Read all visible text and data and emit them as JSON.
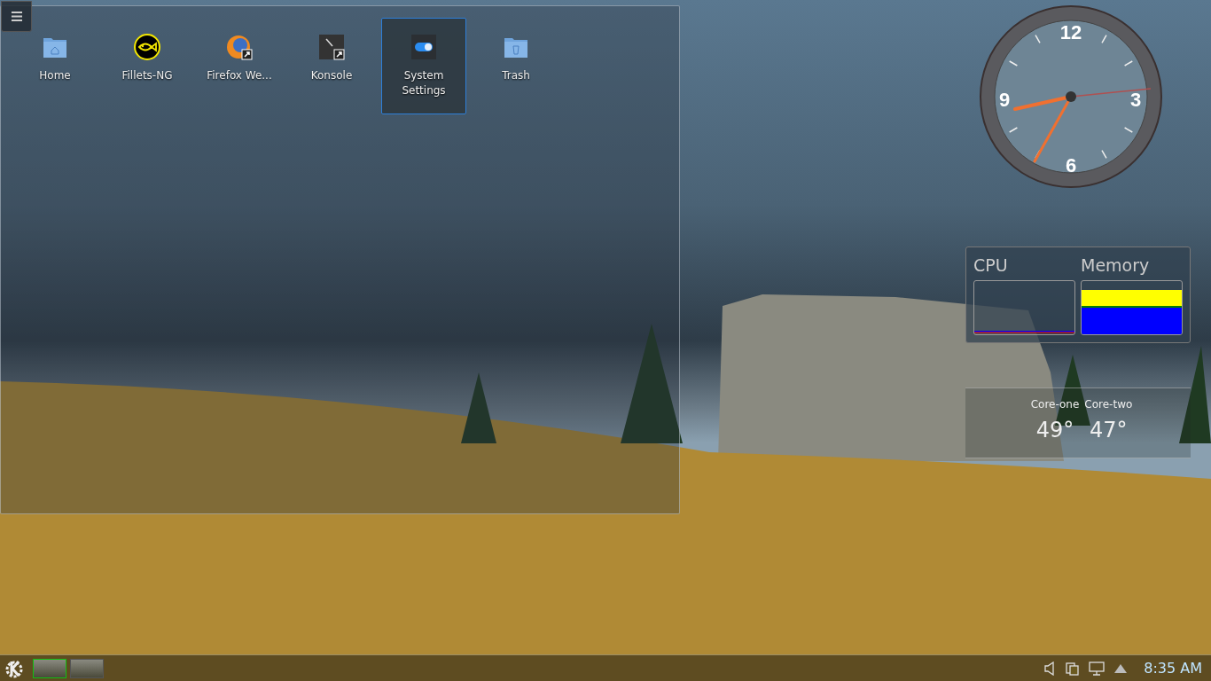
{
  "folder_view": {
    "icons": [
      {
        "label": "Home",
        "kind": "folder",
        "selected": false
      },
      {
        "label": "Fillets-NG",
        "kind": "fish",
        "selected": false
      },
      {
        "label": "Firefox We...",
        "kind": "firefox",
        "selected": false
      },
      {
        "label": "Konsole",
        "kind": "terminal",
        "selected": false
      },
      {
        "label": "System Settings",
        "kind": "settings",
        "selected": true
      },
      {
        "label": "Trash",
        "kind": "trash",
        "selected": false
      }
    ]
  },
  "clock": {
    "numerals": [
      "12",
      "3",
      "6",
      "9"
    ]
  },
  "system_monitor": {
    "meters": [
      {
        "label": "CPU",
        "kind": "cpu"
      },
      {
        "label": "Memory",
        "kind": "memory"
      }
    ]
  },
  "temperatures": [
    {
      "label": "Core-one",
      "reading": "49°"
    },
    {
      "label": "Core-two",
      "reading": "47°"
    }
  ],
  "taskbar": {
    "desktops": [
      {
        "selected": true
      },
      {
        "selected": false
      }
    ],
    "clock": "8:35 AM"
  }
}
